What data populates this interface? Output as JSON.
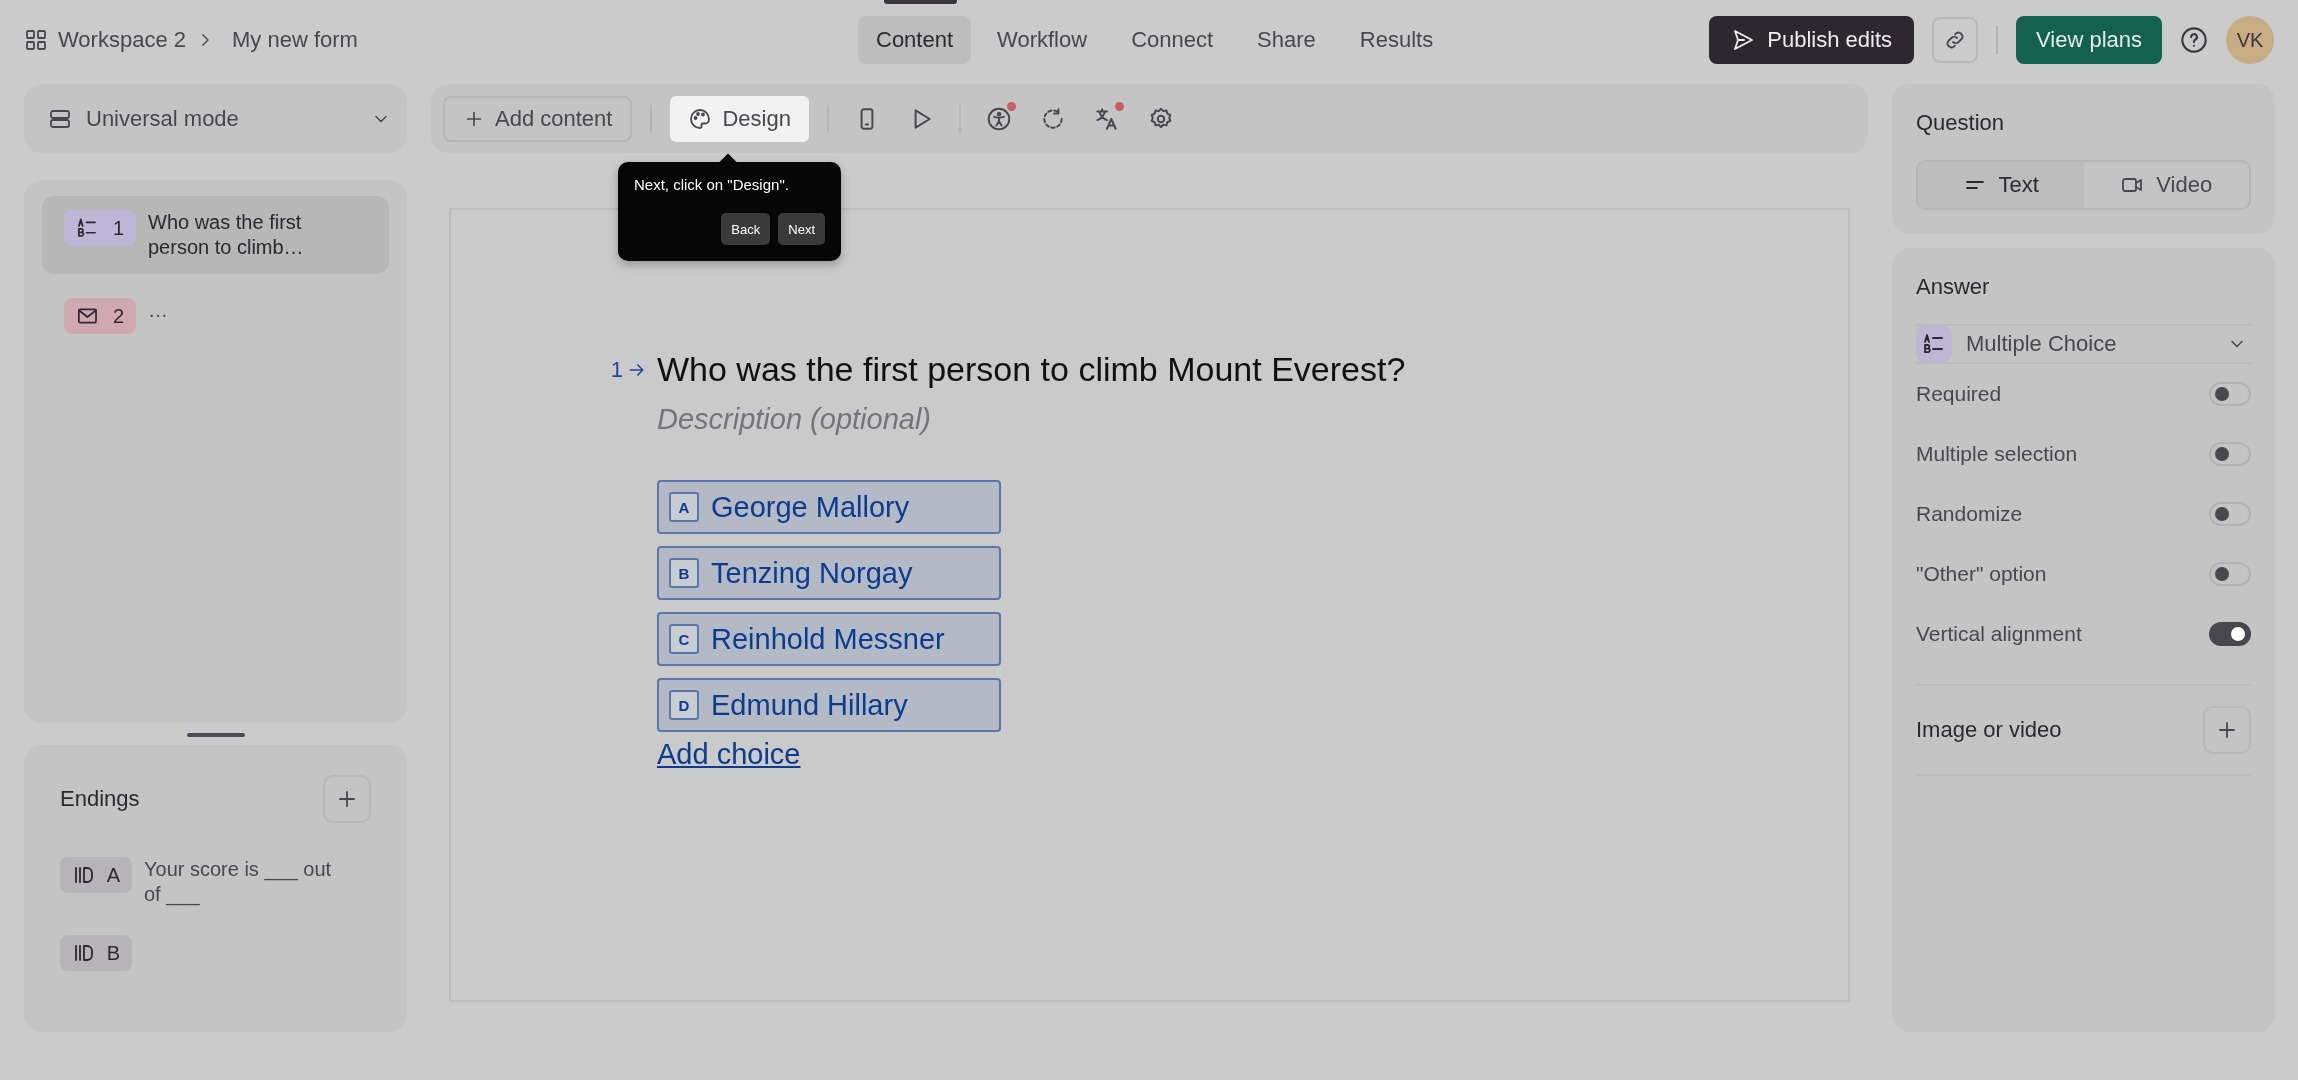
{
  "breadcrumb": {
    "workspace": "Workspace 2",
    "form": "My new form"
  },
  "tabs": [
    {
      "label": "Content",
      "selected": true
    },
    {
      "label": "Workflow",
      "selected": false
    },
    {
      "label": "Connect",
      "selected": false
    },
    {
      "label": "Share",
      "selected": false
    },
    {
      "label": "Results",
      "selected": false
    }
  ],
  "actions": {
    "publish": "Publish edits",
    "plans": "View plans",
    "avatar": "VK"
  },
  "mode_select": {
    "value": "Universal mode"
  },
  "questions": [
    {
      "kind": "choice",
      "number": "1",
      "title": "Who was the first person to climb…",
      "color": "#bdb6d6",
      "selected": true
    },
    {
      "kind": "email",
      "number": "2",
      "title": "…",
      "color": "#d0a8b2",
      "selected": false
    }
  ],
  "endings": {
    "title": "Endings",
    "items": [
      {
        "letter": "A",
        "title": "Your score is ___ out of ___"
      },
      {
        "letter": "B"
      }
    ]
  },
  "toolbar": {
    "add": "Add content",
    "design": {
      "label": "Design",
      "highlighted": true
    },
    "tool_groups": [
      [
        {
          "kind": "phone",
          "badge": false
        },
        {
          "kind": "play",
          "badge": false
        }
      ],
      [
        {
          "kind": "accessibility",
          "badge": true
        },
        {
          "kind": "logic",
          "badge": false
        },
        {
          "kind": "translate",
          "badge": true
        },
        {
          "kind": "settings",
          "badge": false
        }
      ]
    ]
  },
  "tooltip": {
    "text": "Next, click on \"Design\".",
    "buttons": [
      "Back",
      "Next"
    ]
  },
  "question": {
    "number": "1",
    "title": "Who was the first person to climb Mount Everest?",
    "placeholder": "Description (optional)",
    "choices": [
      {
        "key": "A",
        "label": "George Mallory"
      },
      {
        "key": "B",
        "label": "Tenzing Norgay"
      },
      {
        "key": "C",
        "label": "Reinhold Messner"
      },
      {
        "key": "D",
        "label": "Edmund Hillary"
      }
    ],
    "add_choice": "Add choice"
  },
  "settings": {
    "question_title": "Question",
    "media": [
      {
        "kind": "text",
        "label": "Text",
        "selected": true
      },
      {
        "kind": "video",
        "label": "Video",
        "selected": false
      }
    ],
    "answer_title": "Answer",
    "answer_type": "Multiple Choice",
    "toggles": [
      {
        "label": "Required",
        "on": false
      },
      {
        "label": "Multiple selection",
        "on": false
      },
      {
        "label": "Randomize",
        "on": false
      },
      {
        "label": "\"Other\" option",
        "on": false
      },
      {
        "label": "Vertical alignment",
        "on": true
      }
    ],
    "image_label": "Image or video"
  }
}
